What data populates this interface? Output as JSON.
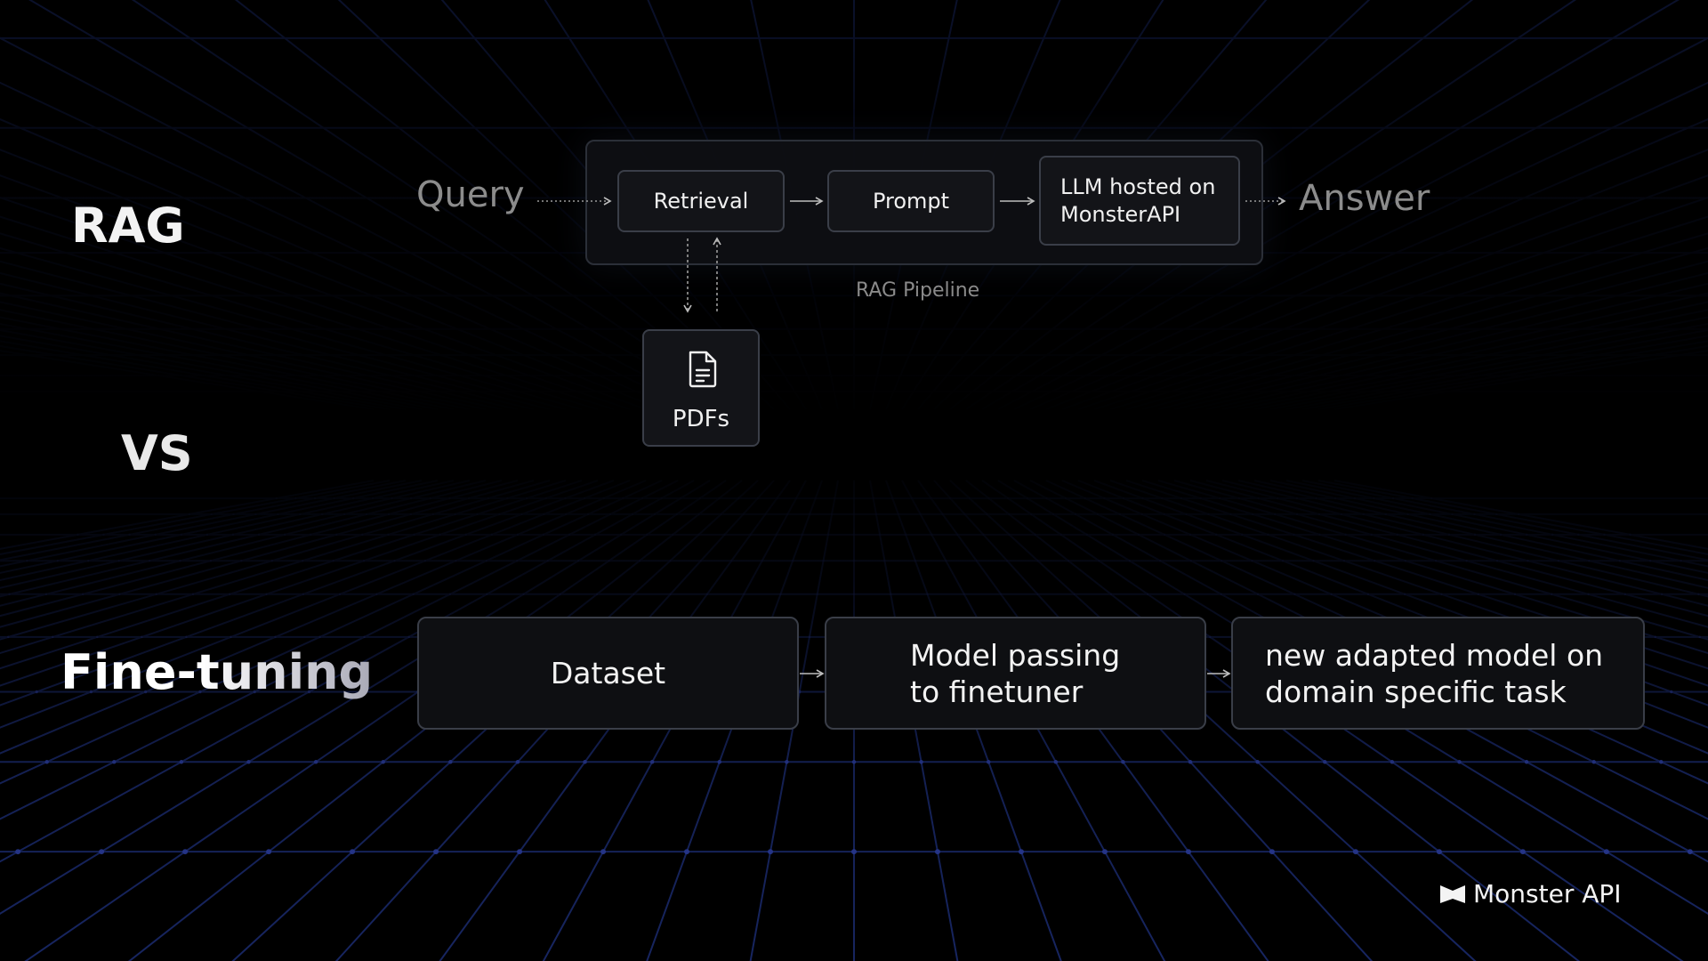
{
  "headings": {
    "rag": "RAG",
    "vs": "VS",
    "fine_tuning": "Fine-tuning"
  },
  "rag_flow": {
    "input": "Query",
    "output": "Answer",
    "pipeline_label": "RAG Pipeline",
    "nodes": {
      "retrieval": "Retrieval",
      "prompt": "Prompt",
      "llm_line1": "LLM hosted on",
      "llm_line2": "MonsterAPI"
    },
    "source": {
      "label": "PDFs",
      "icon": "document-icon"
    }
  },
  "fine_tuning_flow": {
    "steps": {
      "dataset": "Dataset",
      "model_line1": "Model passing",
      "model_line2": "to finetuner",
      "adapted_line1": "new adapted model on",
      "adapted_line2": "domain specific task"
    }
  },
  "brand": {
    "name": "Monster API",
    "icon": "monster-logo-icon"
  },
  "colors": {
    "background": "#000000",
    "grid": "#1a2a6b",
    "box_border": "#3a3e48",
    "muted_text": "#8c8c8c"
  }
}
